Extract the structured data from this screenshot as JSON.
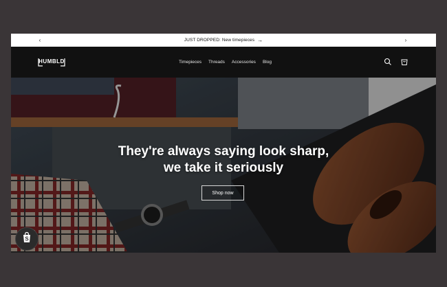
{
  "announcement": {
    "text": "JUST DROPPED: New timepieces",
    "arrow": "→",
    "prev": "‹",
    "next": "›"
  },
  "header": {
    "logo_text": "HUMBLD",
    "nav": [
      "Timepieces",
      "Threads",
      "Accessories",
      "Blog"
    ],
    "icons": [
      "search-icon",
      "cart-icon"
    ]
  },
  "hero": {
    "headline_line1": "They're always saying look sharp,",
    "headline_line2": "we take it seriously",
    "cta_label": "Shop now"
  },
  "badge": {
    "icon": "shopify-bag-icon"
  },
  "colors": {
    "background": "#3a3537",
    "header": "#111111",
    "announcement_bar": "#ffffff",
    "text_light": "#ffffff"
  }
}
